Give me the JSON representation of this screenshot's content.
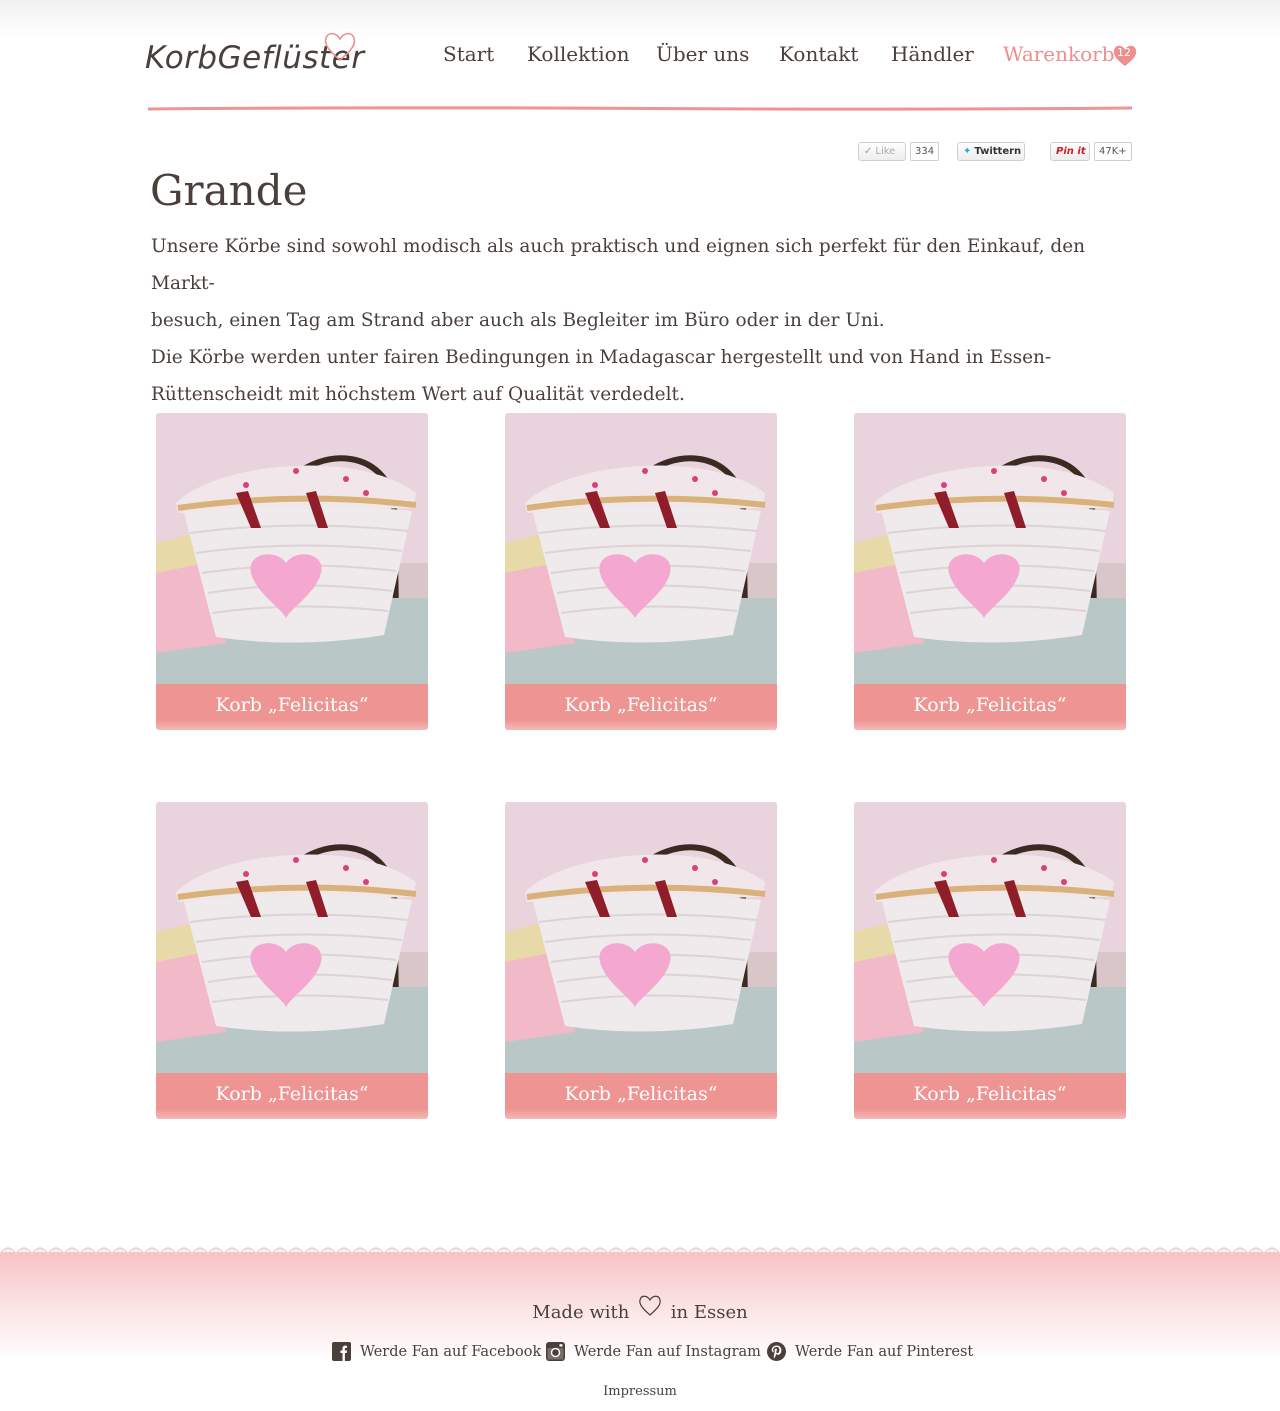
{
  "header": {
    "logo_text": "KorbGeflüster",
    "nav": [
      {
        "label": "Start"
      },
      {
        "label": "Kollektion"
      },
      {
        "label": "Über uns"
      },
      {
        "label": "Kontakt"
      },
      {
        "label": "Händler"
      },
      {
        "label": "Warenkorb"
      }
    ],
    "cart_count": "12"
  },
  "social": {
    "like_label": "Like",
    "like_count": "334",
    "twitter_label": "Twittern",
    "pinit_label": "Pin it",
    "pin_count": "47K+"
  },
  "main": {
    "title": "Grande",
    "intro_lines": [
      "Unsere Körbe sind sowohl modisch als auch praktisch und eignen sich perfekt für den Einkauf, den Markt-",
      "besuch, einen Tag am Strand aber auch als Begleiter im Büro oder in der Uni.",
      "Die Körbe werden unter fairen Bedingungen in Madagascar hergestellt und von Hand in Essen-",
      "Rüttenscheidt mit höchstem Wert auf Qualität verdedelt."
    ],
    "products": [
      {
        "name": "Korb „Felicitas“"
      },
      {
        "name": "Korb „Felicitas“"
      },
      {
        "name": "Korb „Felicitas“"
      },
      {
        "name": "Korb „Felicitas“"
      },
      {
        "name": "Korb „Felicitas“"
      },
      {
        "name": "Korb „Felicitas“"
      }
    ]
  },
  "footer": {
    "made_prefix": "Made with",
    "made_suffix": "in Essen",
    "links": [
      {
        "label": "Werde Fan auf Facebook",
        "icon": "facebook-icon"
      },
      {
        "label": "Werde Fan auf Instagram",
        "icon": "instagram-icon"
      },
      {
        "label": "Werde Fan auf Pinterest",
        "icon": "pinterest-icon"
      }
    ],
    "impressum": "Impressum"
  },
  "colors": {
    "accent": "#ee9593",
    "text": "#4a3f3a",
    "cart": "#ec8f8e"
  }
}
